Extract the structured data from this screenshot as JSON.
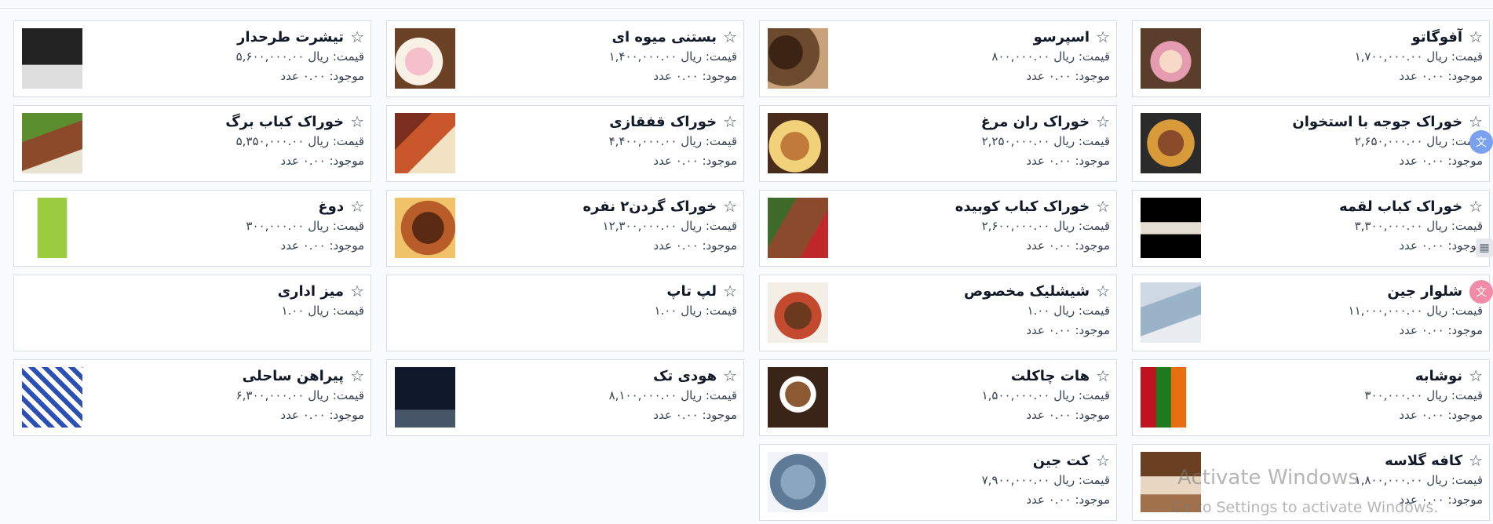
{
  "labels": {
    "price_prefix": "قیمت: ریال",
    "stock_prefix": "موجود:",
    "stock_suffix": "عدد"
  },
  "products": [
    {
      "name": "آفوگاتو",
      "price": "۱,۷۰۰,۰۰۰.۰۰",
      "stock": "۰.۰۰",
      "image": "affogato"
    },
    {
      "name": "اسپرسو",
      "price": "۸۰۰,۰۰۰.۰۰",
      "stock": "۰.۰۰",
      "image": "espresso"
    },
    {
      "name": "بستنی میوه ای",
      "price": "۱,۴۰۰,۰۰۰.۰۰",
      "stock": "۰.۰۰",
      "image": "ice-cream"
    },
    {
      "name": "تیشرت طرحدار",
      "price": "۵,۶۰۰,۰۰۰.۰۰",
      "stock": "۰.۰۰",
      "image": "tshirt"
    },
    {
      "name": "خوراک جوجه با استخوان",
      "price": "۲,۶۵۰,۰۰۰.۰۰",
      "stock": "۰.۰۰",
      "image": "chicken-bone"
    },
    {
      "name": "خوراک ران مرغ",
      "price": "۲,۲۵۰,۰۰۰.۰۰",
      "stock": "۰.۰۰",
      "image": "chicken-thigh"
    },
    {
      "name": "خوراک قفقازی",
      "price": "۴,۴۰۰,۰۰۰.۰۰",
      "stock": "۰.۰۰",
      "image": "caucasian"
    },
    {
      "name": "خوراک کباب برگ",
      "price": "۵,۳۵۰,۰۰۰.۰۰",
      "stock": "۰.۰۰",
      "image": "barg-kebab"
    },
    {
      "name": "خوراک کباب لقمه",
      "price": "۳,۳۰۰,۰۰۰.۰۰",
      "stock": "۰.۰۰",
      "image": "loghmeh-kebab"
    },
    {
      "name": "خوراک کباب کوبیده",
      "price": "۲,۶۰۰,۰۰۰.۰۰",
      "stock": "۰.۰۰",
      "image": "koobideh"
    },
    {
      "name": "خوراک گردن۲ نفره",
      "price": "۱۲,۳۰۰,۰۰۰.۰۰",
      "stock": "۰.۰۰",
      "image": "neck"
    },
    {
      "name": "دوغ",
      "price": "۳۰۰,۰۰۰.۰۰",
      "stock": "۰.۰۰",
      "image": "doogh"
    },
    {
      "name": "شلوار جین",
      "price": "۱۱,۰۰۰,۰۰۰.۰۰",
      "stock": "۰.۰۰",
      "image": "jeans"
    },
    {
      "name": "شیشلیک مخصوص",
      "price": "۱.۰۰",
      "stock": "۰.۰۰",
      "image": "shishlik"
    },
    {
      "name": "لپ تاپ",
      "price": "۱.۰۰",
      "stock": "",
      "image": ""
    },
    {
      "name": "میز اداری",
      "price": "۱.۰۰",
      "stock": "",
      "image": ""
    },
    {
      "name": "نوشابه",
      "price": "۳۰۰,۰۰۰.۰۰",
      "stock": "۰.۰۰",
      "image": "soda"
    },
    {
      "name": "هات چاکلت",
      "price": "۱,۵۰۰,۰۰۰.۰۰",
      "stock": "۰.۰۰",
      "image": "hot-chocolate"
    },
    {
      "name": "هودی تک",
      "price": "۸,۱۰۰,۰۰۰.۰۰",
      "stock": "۰.۰۰",
      "image": "hoodie"
    },
    {
      "name": "پیراهن ساحلی",
      "price": "۶,۳۰۰,۰۰۰.۰۰",
      "stock": "۰.۰۰",
      "image": "beach-shirt"
    },
    {
      "name": "کافه گلاسه",
      "price": "۱,۸۰۰,۰۰۰.۰۰",
      "stock": "۰.۰۰",
      "image": "cafe-glace"
    },
    {
      "name": "کت جین",
      "price": "۷,۹۰۰,۰۰۰.۰۰",
      "stock": "۰.۰۰",
      "image": "denim-jacket"
    }
  ],
  "watermark": {
    "title": "Activate Windows",
    "subtitle": "Go to Settings to activate Windows."
  }
}
